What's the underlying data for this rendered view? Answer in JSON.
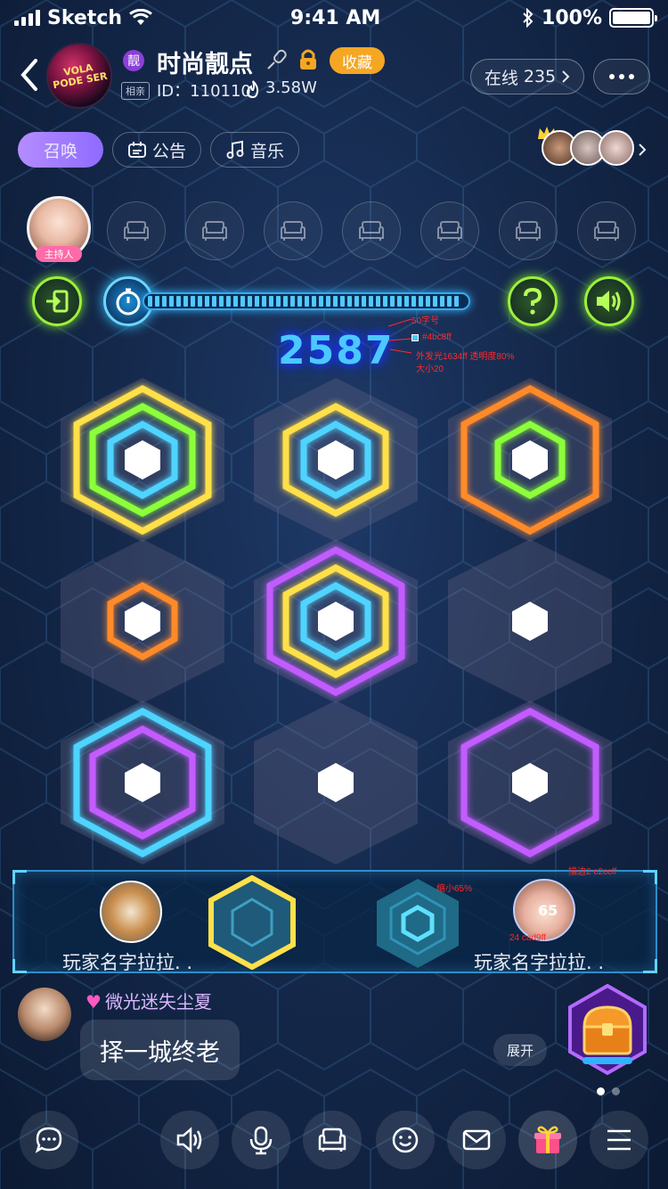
{
  "status_bar": {
    "carrier": "Sketch",
    "time": "9:41 AM",
    "battery": "100%"
  },
  "room": {
    "vip_badge": "靓",
    "title": "时尚靓点",
    "tag": "相亲",
    "id_text": "ID：110110",
    "heat": "3.58W",
    "favorite_label": "收藏",
    "avatar_text": "VOLA PODE SER",
    "online_label": "在线",
    "online_count": "235"
  },
  "tabs": [
    {
      "label": "召唤"
    },
    {
      "label": "公告"
    },
    {
      "label": "音乐"
    }
  ],
  "host": {
    "label": "主持人"
  },
  "game": {
    "score": "2587",
    "score_color": "#4bc8ff",
    "glow_color": "#1634ff",
    "progress": 1.0
  },
  "annotations": {
    "font_size": "50字号",
    "color": "#4bc8ff",
    "glow": "外发光1634ff 透明度80%",
    "glow_size": "大小20",
    "scale": "缩小65%",
    "stroke": "描边2 c2ccff",
    "avatar_size": "24 cad9ff"
  },
  "players": [
    {
      "name": "玩家名字拉拉. .",
      "score": ""
    },
    {
      "name": "玩家名字拉拉. .",
      "score": "65"
    }
  ],
  "chat": {
    "sender": "微光迷失尘夏",
    "message": "择一城终老",
    "expand_label": "展开"
  }
}
